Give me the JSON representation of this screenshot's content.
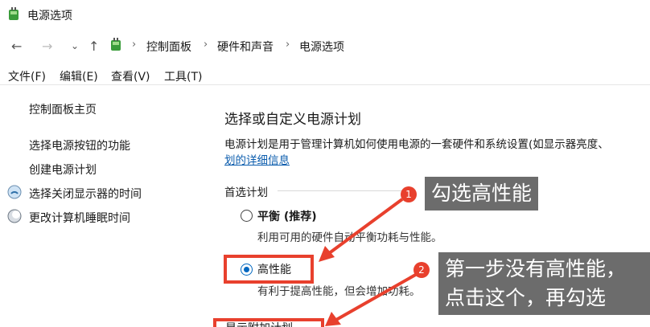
{
  "window": {
    "title": "电源选项"
  },
  "address": {
    "crumbs": [
      "控制面板",
      "硬件和声音",
      "电源选项"
    ]
  },
  "menu": [
    "文件(F)",
    "编辑(E)",
    "查看(V)",
    "工具(T)"
  ],
  "sidebar": {
    "home": "控制面板主页",
    "items": [
      {
        "label": "选择电源按钮的功能"
      },
      {
        "label": "创建电源计划"
      },
      {
        "label": "选择关闭显示器的时间",
        "icon": "monitor-icon"
      },
      {
        "label": "更改计算机睡眠时间",
        "icon": "sleep-icon"
      }
    ]
  },
  "main": {
    "title": "选择或自定义电源计划",
    "description": "电源计划是用于管理计算机如何使用电源的一套硬件和系统设置(如显示器亮度、",
    "link": "划的详细信息",
    "group_label": "首选计划",
    "plans": [
      {
        "name": "平衡 (推荐)",
        "desc": "利用可用的硬件自动平衡功耗与性能。",
        "checked": false
      },
      {
        "name": "高性能",
        "desc": "有利于提高性能，但会增加功耗。",
        "checked": true
      }
    ],
    "partial_hidden_label": "显示附加计划"
  },
  "annotations": {
    "badge1": "1",
    "callout1": "勾选高性能",
    "badge2": "2",
    "callout2_line1": "第一步没有高性能，",
    "callout2_line2": "点击这个，再勾选",
    "accent_color": "#e8402d"
  }
}
